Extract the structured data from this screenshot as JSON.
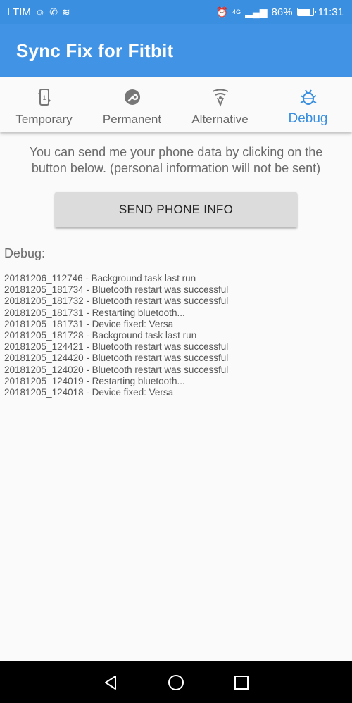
{
  "status_bar": {
    "carrier": "I TIM",
    "network": "4G",
    "battery_percent": "86%",
    "time": "11:31"
  },
  "app_bar": {
    "title": "Sync Fix for Fitbit"
  },
  "tabs": [
    {
      "label": "Temporary",
      "icon": "sync-phone-icon",
      "active": false
    },
    {
      "label": "Permanent",
      "icon": "wrench-icon",
      "active": false
    },
    {
      "label": "Alternative",
      "icon": "antenna-icon",
      "active": false
    },
    {
      "label": "Debug",
      "icon": "bug-icon",
      "active": true
    }
  ],
  "content": {
    "intro": "You can send me your phone data by clicking on the button below. (personal information will not be sent)",
    "send_button": "SEND PHONE INFO",
    "debug_label": "Debug:",
    "log": [
      "20181206_112746 - Background task last run",
      "20181205_181734 - Bluetooth restart was successful",
      "20181205_181732 - Bluetooth restart was successful",
      "20181205_181731 - Restarting bluetooth...",
      "20181205_181731 - Device fixed: Versa",
      "20181205_181728 - Background task last run",
      "20181205_124421 - Bluetooth restart was successful",
      "20181205_124420 - Bluetooth restart was successful",
      "20181205_124020 - Bluetooth restart was successful",
      "20181205_124019 - Restarting bluetooth...",
      "20181205_124018 - Device fixed: Versa"
    ]
  },
  "colors": {
    "accent": "#3a8fe0",
    "app_bar": "#4193e6"
  }
}
